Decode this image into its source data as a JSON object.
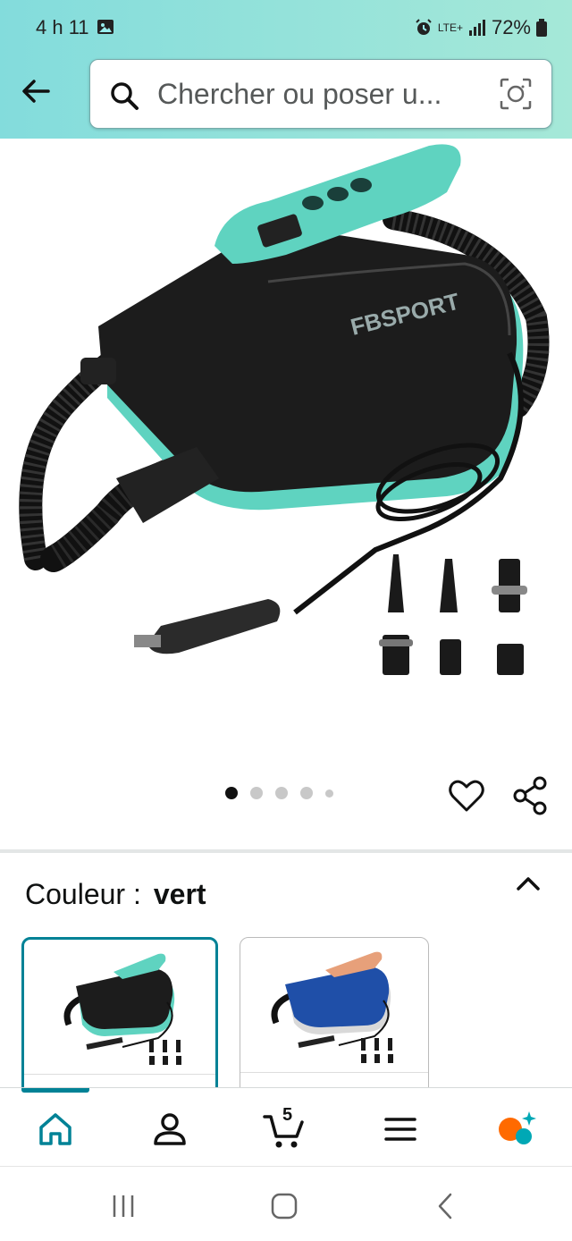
{
  "status_bar": {
    "time": "4 h 11",
    "network": "LTE+",
    "battery": "72%"
  },
  "search": {
    "placeholder": "Chercher ou poser u..."
  },
  "product": {
    "brand_on_device": "FBSPORT",
    "carousel": {
      "total": 5,
      "active": 1
    }
  },
  "variation": {
    "label": "Couleur :",
    "value": "vert",
    "options": [
      {
        "name": "vert",
        "selected": true,
        "accent": "#5fd3c0"
      },
      {
        "name": "bleu",
        "selected": false,
        "accent": "#1f4fa8"
      }
    ]
  },
  "bottom_nav": {
    "cart_count": "5",
    "active_item": "home",
    "accent_color": "#008296"
  },
  "colors": {
    "header_gradient_start": "#83dcdc",
    "header_gradient_end": "#a5e8d8",
    "selected_border": "#008296"
  }
}
